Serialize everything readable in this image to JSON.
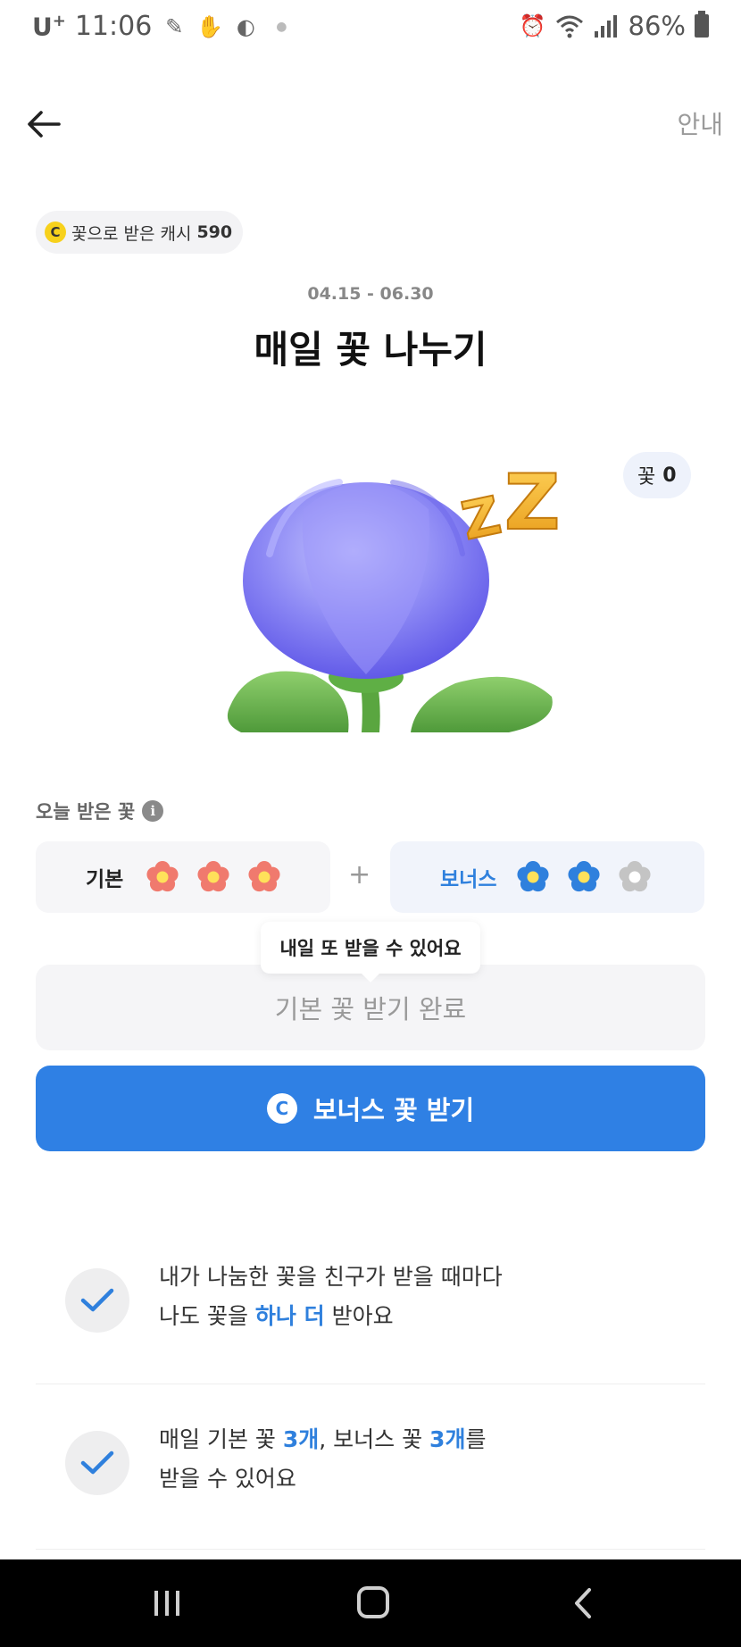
{
  "status_bar": {
    "carrier": "U",
    "carrier_sup": "+",
    "time": "11:06",
    "battery": "86%",
    "icons": [
      "pen-icon",
      "hand-icon",
      "app-icon",
      "dot-icon",
      "alarm-icon",
      "wifi-icon",
      "signal-icon",
      "battery-icon"
    ]
  },
  "header": {
    "guide_label": "안내"
  },
  "cash_chip": {
    "coin_glyph": "C",
    "label": "꽃으로 받은 캐시",
    "value": "590"
  },
  "event": {
    "period": "04.15 - 06.30",
    "title": "매일 꽃 나누기"
  },
  "flower_count": {
    "label": "꽃",
    "value": "0"
  },
  "today": {
    "label": "오늘 받은 꽃",
    "info_glyph": "i",
    "basic": {
      "label": "기본",
      "flowers": [
        {
          "state": "received",
          "color": "#f07a6e"
        },
        {
          "state": "received",
          "color": "#f07a6e"
        },
        {
          "state": "received",
          "color": "#f07a6e"
        }
      ]
    },
    "plus": "+",
    "bonus": {
      "label": "보너스",
      "flowers": [
        {
          "state": "received",
          "color": "#2f80dd"
        },
        {
          "state": "received",
          "color": "#2f80dd"
        },
        {
          "state": "empty",
          "color": "#c4c4c4"
        }
      ]
    }
  },
  "tooltip": "내일 또 받을 수 있어요",
  "done_button": "기본 꽃 받기 완료",
  "bonus_button": {
    "coin_glyph": "C",
    "label": "보너스 꽃 받기"
  },
  "benefits": [
    {
      "line1": "내가 나눔한 꽃을 친구가 받을 때마다",
      "line2_pre": "나도 꽃을 ",
      "line2_hl": "하나 더",
      "line2_post": " 받아요"
    },
    {
      "line1_a": "매일 기본 꽃 ",
      "line1_hl1": "3개",
      "line1_b": ", 보너스 꽃 ",
      "line1_hl2": "3개",
      "line1_c": "를",
      "line2": "받을 수 있어요"
    }
  ],
  "colors": {
    "accent": "#2f80e4",
    "basic_flower": "#f07a6e",
    "bonus_flower": "#2f80dd",
    "empty_flower": "#c4c4c4",
    "coin": "#f7d11c"
  }
}
